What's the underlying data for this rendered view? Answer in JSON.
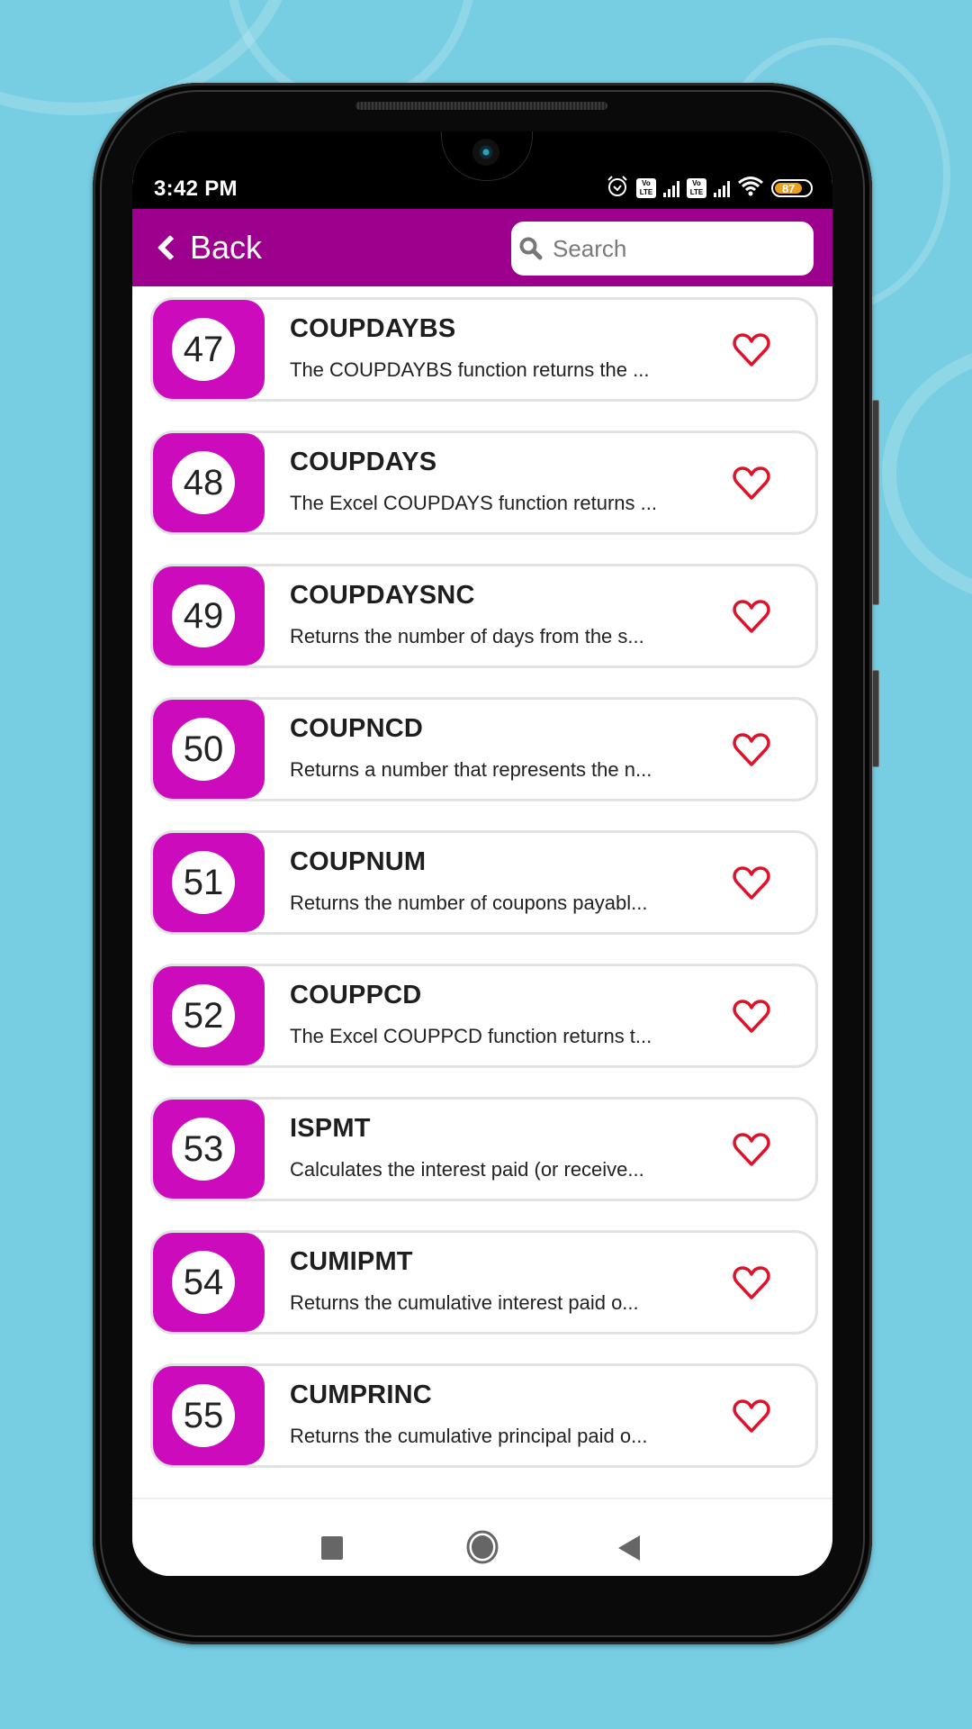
{
  "status_bar": {
    "time": "3:42 PM",
    "volte_label": "Vo LTE",
    "battery_level": "87",
    "icons": [
      "alarm-icon",
      "volte-icon",
      "signal-icon",
      "volte-icon",
      "signal-icon",
      "wifi-icon",
      "battery-icon"
    ]
  },
  "header": {
    "back_label": "Back",
    "search_placeholder": "Search",
    "search_value": ""
  },
  "colors": {
    "header_bg": "#9d008c",
    "number_block": "#cc0bbd",
    "heart": "#e0122a",
    "background": "#77cde2"
  },
  "items": [
    {
      "number": "47",
      "title": "COUPDAYBS",
      "description": "The COUPDAYBS function returns the ...",
      "favorite": false
    },
    {
      "number": "48",
      "title": "COUPDAYS",
      "description": "The Excel COUPDAYS function returns ...",
      "favorite": false
    },
    {
      "number": "49",
      "title": "COUPDAYSNC",
      "description": "Returns the number of days from the s...",
      "favorite": false
    },
    {
      "number": "50",
      "title": "COUPNCD",
      "description": "Returns a number that represents the n...",
      "favorite": false
    },
    {
      "number": "51",
      "title": "COUPNUM",
      "description": "Returns the number of coupons payabl...",
      "favorite": false
    },
    {
      "number": "52",
      "title": "COUPPCD",
      "description": "The Excel COUPPCD function returns t...",
      "favorite": false
    },
    {
      "number": "53",
      "title": "ISPMT",
      "description": "Calculates the interest paid (or receive...",
      "favorite": false
    },
    {
      "number": "54",
      "title": "CUMIPMT",
      "description": "Returns the cumulative interest paid o...",
      "favorite": false
    },
    {
      "number": "55",
      "title": "CUMPRINC",
      "description": "Returns the cumulative principal paid o...",
      "favorite": false
    }
  ],
  "nav": [
    "recents-button",
    "home-button",
    "back-nav-button"
  ]
}
